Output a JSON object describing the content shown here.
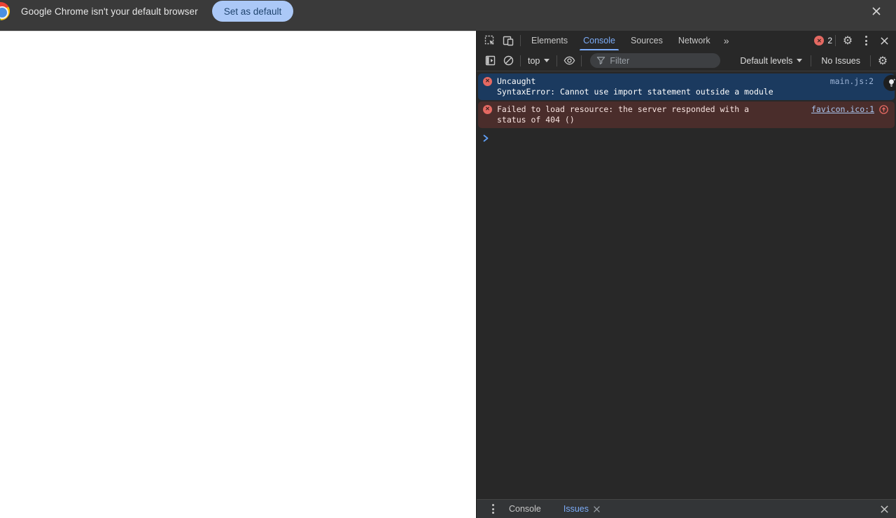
{
  "notification_bar": {
    "message": "Google Chrome isn't your default browser",
    "set_default_button": "Set as default"
  },
  "devtools": {
    "tabs": {
      "items": [
        {
          "label": "Elements"
        },
        {
          "label": "Console"
        },
        {
          "label": "Sources"
        },
        {
          "label": "Network"
        }
      ],
      "more": "»",
      "error_count": "2"
    },
    "toolbar": {
      "context": "top",
      "filter_placeholder": "Filter",
      "levels": "Default levels",
      "issues": "No Issues"
    },
    "console": {
      "messages": [
        {
          "line1": "Uncaught",
          "line2": "SyntaxError: Cannot use import statement outside a module",
          "source": "main.js:2"
        },
        {
          "line1": "Failed to load resource: the server responded with a",
          "line2": "status of 404 ()",
          "source": "favicon.ico:1"
        }
      ]
    },
    "drawer": {
      "console_tab": "Console",
      "issues_tab": "Issues"
    },
    "colors": {
      "accent_blue": "#7cacf8",
      "error_red": "#e46962",
      "selected_row_bg": "#1b3a5f",
      "error_row_bg": "#4a2d2b",
      "button_bg": "#abc8f7"
    }
  }
}
